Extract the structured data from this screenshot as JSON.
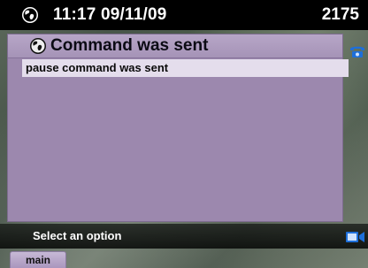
{
  "status_bar": {
    "datetime": "11:17 09/11/09",
    "extension": "2175",
    "globe_icon": "globe-icon"
  },
  "panel": {
    "title": "Command was sent",
    "title_icon": "globe-icon",
    "message": "pause command was sent"
  },
  "bottom_bar": {
    "prompt": "Select an option",
    "video_icon": "video-icon"
  },
  "side_icons": {
    "phone_icon": "phone-icon"
  },
  "softkeys": {
    "main_label": "main"
  },
  "colors": {
    "panel_bg": "#9c88ae",
    "header_bg": "#b7a6c7",
    "message_bg": "#e4ddec",
    "accent_blue": "#1e6fd9"
  }
}
